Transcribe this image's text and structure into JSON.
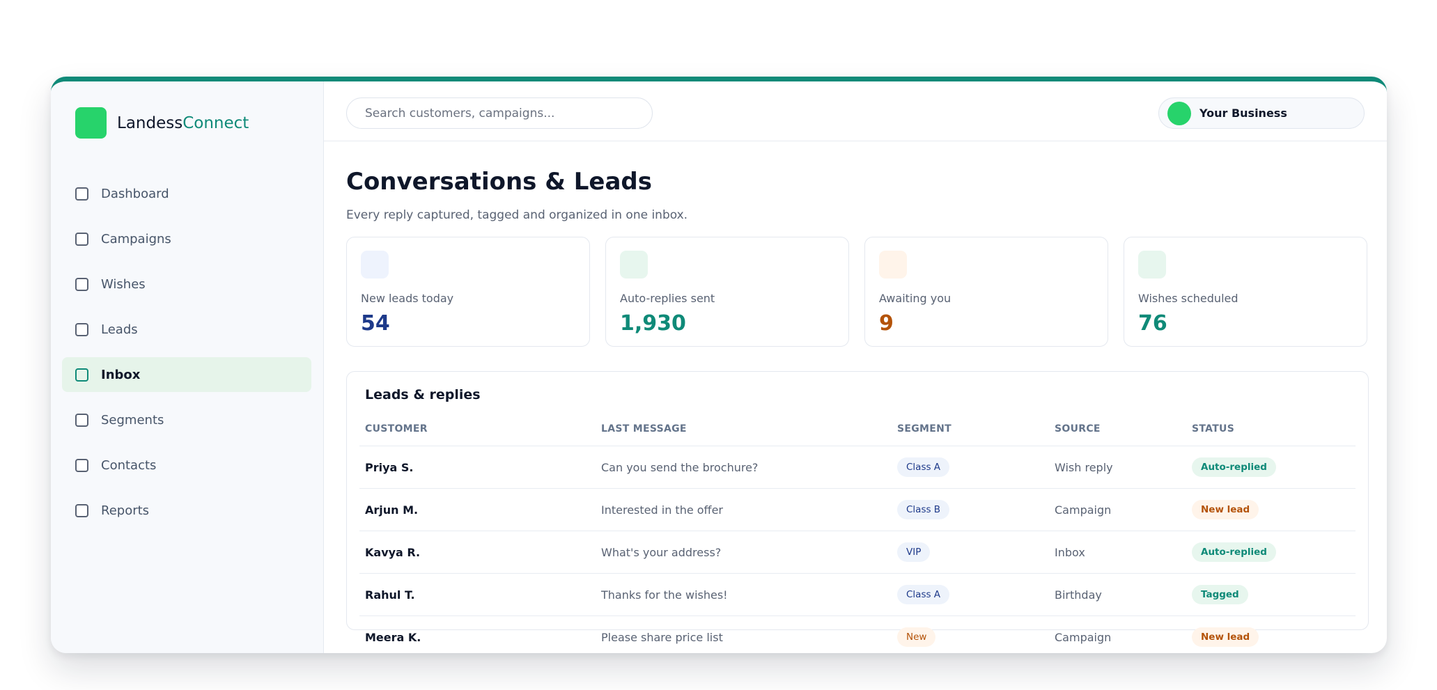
{
  "brand": {
    "name_part1": "Landess",
    "name_part2": "Connect"
  },
  "nav": [
    {
      "label": "Dashboard",
      "active": false
    },
    {
      "label": "Campaigns",
      "active": false
    },
    {
      "label": "Wishes",
      "active": false
    },
    {
      "label": "Leads",
      "active": false
    },
    {
      "label": "Inbox",
      "active": true
    },
    {
      "label": "Segments",
      "active": false
    },
    {
      "label": "Contacts",
      "active": false
    },
    {
      "label": "Reports",
      "active": false
    }
  ],
  "search": {
    "placeholder": "Search customers, campaigns..."
  },
  "account": {
    "name": "Your Business"
  },
  "page": {
    "title": "Conversations & Leads",
    "subtitle": "Every reply captured, tagged and organized in one inbox."
  },
  "stats": [
    {
      "label": "New leads today",
      "value": "54",
      "value_color": "#1e3a8a",
      "chip_color": "#eef3fd"
    },
    {
      "label": "Auto-replies sent",
      "value": "1,930",
      "value_color": "#0f8a78",
      "chip_color": "#e7f6ee"
    },
    {
      "label": "Awaiting you",
      "value": "9",
      "value_color": "#b45309",
      "chip_color": "#fff4ea"
    },
    {
      "label": "Wishes scheduled",
      "value": "76",
      "value_color": "#0f8a78",
      "chip_color": "#e7f6ee"
    }
  ],
  "table": {
    "title": "Leads & replies",
    "headers": {
      "customer": "CUSTOMER",
      "last_message": "LAST MESSAGE",
      "segment": "SEGMENT",
      "source": "SOURCE",
      "status": "STATUS"
    },
    "rows": [
      {
        "customer": "Priya S.",
        "last_message": "Can you send the brochure?",
        "segment": "Class A",
        "source": "Wish reply",
        "status": "Auto-replied",
        "status_kind": "auto",
        "segment_kind": "cool"
      },
      {
        "customer": "Arjun M.",
        "last_message": "Interested in the offer",
        "segment": "Class B",
        "source": "Campaign",
        "status": "New lead",
        "status_kind": "new",
        "segment_kind": "cool"
      },
      {
        "customer": "Kavya R.",
        "last_message": "What's your address?",
        "segment": "VIP",
        "source": "Inbox",
        "status": "Auto-replied",
        "status_kind": "auto",
        "segment_kind": "cool"
      },
      {
        "customer": "Rahul T.",
        "last_message": "Thanks for the wishes!",
        "segment": "Class A",
        "source": "Birthday",
        "status": "Tagged",
        "status_kind": "tag",
        "segment_kind": "cool"
      },
      {
        "customer": "Meera K.",
        "last_message": "Please share price list",
        "segment": "New",
        "source": "Campaign",
        "status": "New lead",
        "status_kind": "new",
        "segment_kind": "warm"
      }
    ]
  },
  "colors": {
    "accent": "#0f8a78",
    "brand_green": "#27d36b",
    "active_nav_bg": "#e6f4ea"
  }
}
